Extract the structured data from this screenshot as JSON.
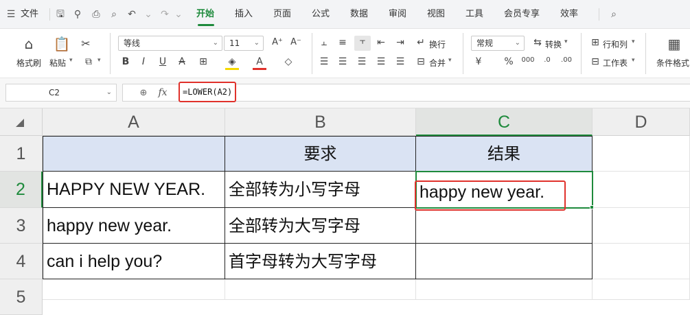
{
  "menubar": {
    "file_label": "文件",
    "tabs": [
      {
        "label": "开始",
        "active": true
      },
      {
        "label": "插入"
      },
      {
        "label": "页面"
      },
      {
        "label": "公式"
      },
      {
        "label": "数据"
      },
      {
        "label": "审阅"
      },
      {
        "label": "视图"
      },
      {
        "label": "工具"
      },
      {
        "label": "会员专享"
      },
      {
        "label": "效率"
      }
    ]
  },
  "ribbon": {
    "format_painter": "格式刷",
    "paste": "粘贴",
    "font_name": "等线",
    "font_size": "11",
    "wrap": "换行",
    "merge": "合并",
    "number_format": "常规",
    "convert": "转换",
    "row_col": "行和列",
    "worksheet": "工作表",
    "cond_format": "条件格式"
  },
  "formula_bar": {
    "name_box": "C2",
    "fx_label": "fx",
    "formula": "=LOWER(A2)"
  },
  "sheet": {
    "columns": [
      "A",
      "B",
      "C",
      "D"
    ],
    "rows": [
      "1",
      "2",
      "3",
      "4",
      "5"
    ],
    "selected_cell": "C2",
    "cells": {
      "A1": "",
      "B1": "要求",
      "C1": "结果",
      "A2": "HAPPY NEW YEAR.",
      "B2": "全部转为小写字母",
      "C2": "happy new year.",
      "A3": "happy new year.",
      "B3": "全部转为大写字母",
      "C3": "",
      "A4": "can i help you?",
      "B4": "首字母转为大写字母",
      "C4": ""
    }
  },
  "colors": {
    "accent": "#1e8a3c",
    "highlight": "#e0312b",
    "header_fill": "#dae3f3"
  }
}
